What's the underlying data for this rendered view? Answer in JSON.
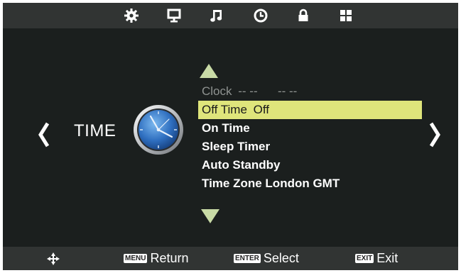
{
  "topbar": {
    "icons": [
      "gear-icon",
      "monitor-icon",
      "music-note-icon",
      "clock-icon",
      "lock-icon",
      "grid-icon"
    ]
  },
  "category": {
    "label": "TIME"
  },
  "menu": {
    "items": [
      {
        "label": "Clock",
        "value": "-- --      -- --",
        "state": "disabled"
      },
      {
        "label": "Off Time",
        "value": "Off",
        "state": "selected"
      },
      {
        "label": "On Time",
        "value": "",
        "state": "normal"
      },
      {
        "label": "Sleep Timer",
        "value": "",
        "state": "normal"
      },
      {
        "label": "Auto Standby",
        "value": "",
        "state": "normal"
      },
      {
        "label": "Time Zone London GMT",
        "value": "",
        "state": "normal"
      }
    ]
  },
  "bottombar": {
    "menu_key": "MENU",
    "menu_label": "Return",
    "enter_key": "ENTER",
    "enter_label": "Select",
    "exit_key": "EXIT",
    "exit_label": "Exit"
  },
  "colors": {
    "background": "#1b1f1e",
    "bars": "#313433",
    "highlight": "#dfe57b",
    "accent_arrows": "#c9dba6"
  }
}
